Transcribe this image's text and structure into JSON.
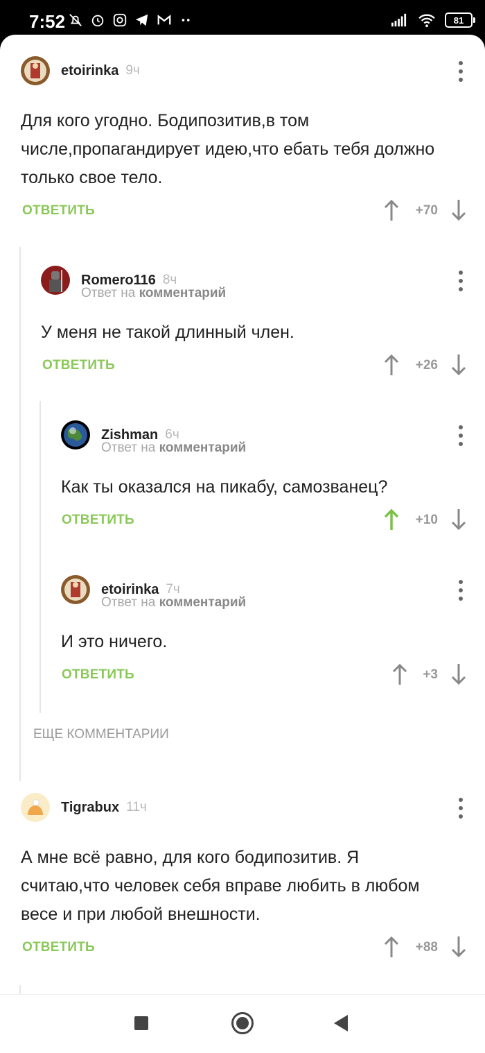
{
  "status_bar": {
    "time": "7:52",
    "battery": "81",
    "left_icons": [
      "muted-bell-icon",
      "alarm-icon",
      "instagram-icon",
      "telegram-icon",
      "gmail-icon",
      "more-dots-icon"
    ],
    "right_icons": [
      "signal-icon",
      "wifi-icon",
      "battery-icon"
    ]
  },
  "labels": {
    "reply": "ОТВЕТИТЬ",
    "reply_to_prefix": "Ответ на",
    "reply_to_link": "комментарий",
    "more_comments": "ЕЩЕ КОММЕНТАРИИ"
  },
  "colors": {
    "accent_green": "#8ac858",
    "text": "#222222",
    "muted": "#a8a8a8"
  },
  "comments": [
    {
      "author": "etoirinka",
      "time": "9ч",
      "text": "Для кого угодно. Бодипозитив,в том числе,пропагандирует идею,что ебать тебя должно только свое тело.",
      "rating": "+70",
      "upvoted": false
    },
    {
      "author": "Romero116",
      "time": "8ч",
      "text": "У меня не такой длинный член.",
      "rating": "+26",
      "upvoted": false
    },
    {
      "author": "Zishman",
      "time": "6ч",
      "text": "Как ты оказался на пикабу, самозванец?",
      "rating": "+10",
      "upvoted": true
    },
    {
      "author": "etoirinka",
      "time": "7ч",
      "text": "И это ничего.",
      "rating": "+3",
      "upvoted": false
    },
    {
      "author": "Tigrabux",
      "time": "11ч",
      "text": "А мне всё равно, для кого бодипозитив. Я считаю,что человек себя вправе любить в любом весе и при любой внешности.",
      "rating": "+88",
      "upvoted": false
    }
  ],
  "nav_bar": [
    "recents-square-icon",
    "home-circle-icon",
    "back-triangle-icon"
  ]
}
